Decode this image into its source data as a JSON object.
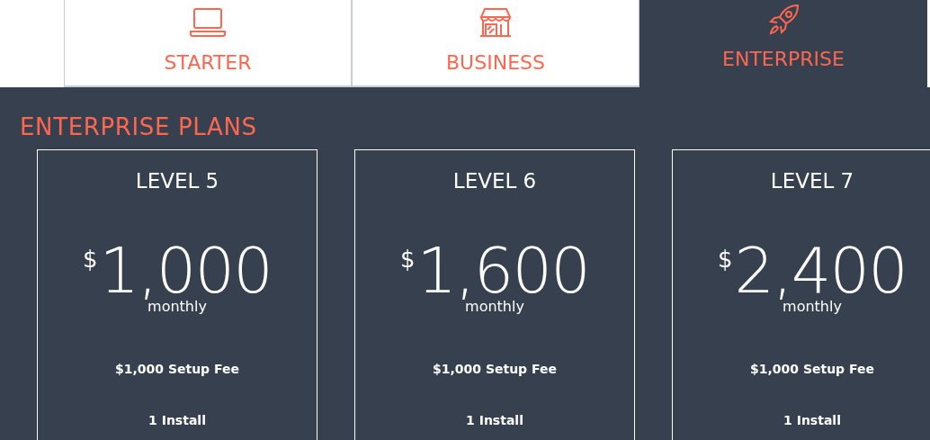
{
  "tabs": [
    {
      "label": "STARTER",
      "selected": false
    },
    {
      "label": "BUSINESS",
      "selected": false
    },
    {
      "label": "ENTERPRISE",
      "selected": true
    }
  ],
  "heading": "ENTERPRISE PLANS",
  "plans": [
    {
      "name": "LEVEL 5",
      "currency": "$",
      "price": "1,000",
      "period": "monthly",
      "setup": "$1,000 Setup Fee",
      "installs": "1 Install"
    },
    {
      "name": "LEVEL 6",
      "currency": "$",
      "price": "1,600",
      "period": "monthly",
      "setup": "$1,000 Setup Fee",
      "installs": "1 Install"
    },
    {
      "name": "LEVEL 7",
      "currency": "$",
      "price": "2,400",
      "period": "monthly",
      "setup": "$1,000 Setup Fee",
      "installs": "1 Install"
    }
  ]
}
